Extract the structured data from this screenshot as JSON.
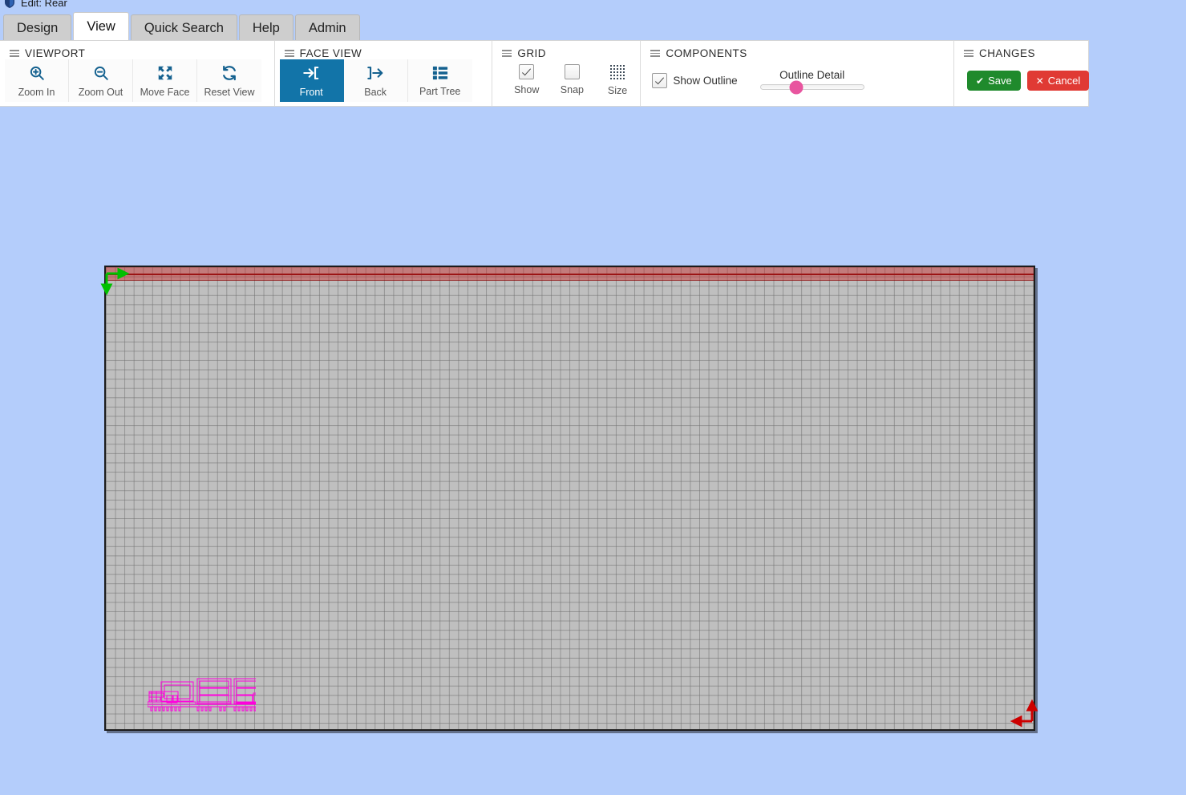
{
  "window": {
    "title": "Edit: Rear",
    "icon": "shield-icon"
  },
  "tabs": [
    {
      "label": "Design",
      "active": false
    },
    {
      "label": "View",
      "active": true
    },
    {
      "label": "Quick Search",
      "active": false
    },
    {
      "label": "Help",
      "active": false
    },
    {
      "label": "Admin",
      "active": false
    }
  ],
  "ribbon": {
    "groups": {
      "viewport": {
        "title": "VIEWPORT",
        "buttons": [
          {
            "label": "Zoom In",
            "icon": "zoom-in-icon"
          },
          {
            "label": "Zoom Out",
            "icon": "zoom-out-icon"
          },
          {
            "label": "Move Face",
            "icon": "move-face-icon"
          },
          {
            "label": "Reset View",
            "icon": "reset-view-icon"
          }
        ]
      },
      "face_view": {
        "title": "FACE VIEW",
        "buttons": [
          {
            "label": "Front",
            "icon": "arrow-into-icon",
            "active": true
          },
          {
            "label": "Back",
            "icon": "arrow-out-icon",
            "active": false
          },
          {
            "label": "Part Tree",
            "icon": "list-tree-icon",
            "active": false
          }
        ]
      },
      "grid": {
        "title": "GRID",
        "controls": [
          {
            "label": "Show",
            "type": "checkbox",
            "checked": true
          },
          {
            "label": "Snap",
            "type": "checkbox",
            "checked": false
          },
          {
            "label": "Size",
            "type": "icon-button",
            "icon": "dot-grid-icon"
          }
        ]
      },
      "components": {
        "title": "COMPONENTS",
        "show_outline": {
          "label": "Show Outline",
          "checked": true
        },
        "outline_detail": {
          "label": "Outline Detail",
          "value": 35,
          "min": 0,
          "max": 100,
          "accent": "#e8559f"
        }
      },
      "changes": {
        "title": "CHANGES",
        "save": {
          "label": "Save",
          "icon": "check-icon",
          "color": "#1f8a2c"
        },
        "cancel": {
          "label": "Cancel",
          "icon": "x-icon",
          "color": "#e03a34"
        }
      }
    }
  },
  "viewport": {
    "background": "#b4cdfb",
    "board": {
      "fill": "#bfbfbf",
      "border": "#1c1c1c",
      "grid_on": true,
      "grid_color": "#6e6e6e",
      "top_band_color": "#c82828"
    },
    "origin_axis": {
      "name": "origin-axes",
      "color": "#00d000",
      "corner": "top-left"
    },
    "far_axis": {
      "name": "far-axes",
      "color": "#cc0000",
      "corner": "bottom-right"
    },
    "component_outline_color": "#ff00dd"
  }
}
